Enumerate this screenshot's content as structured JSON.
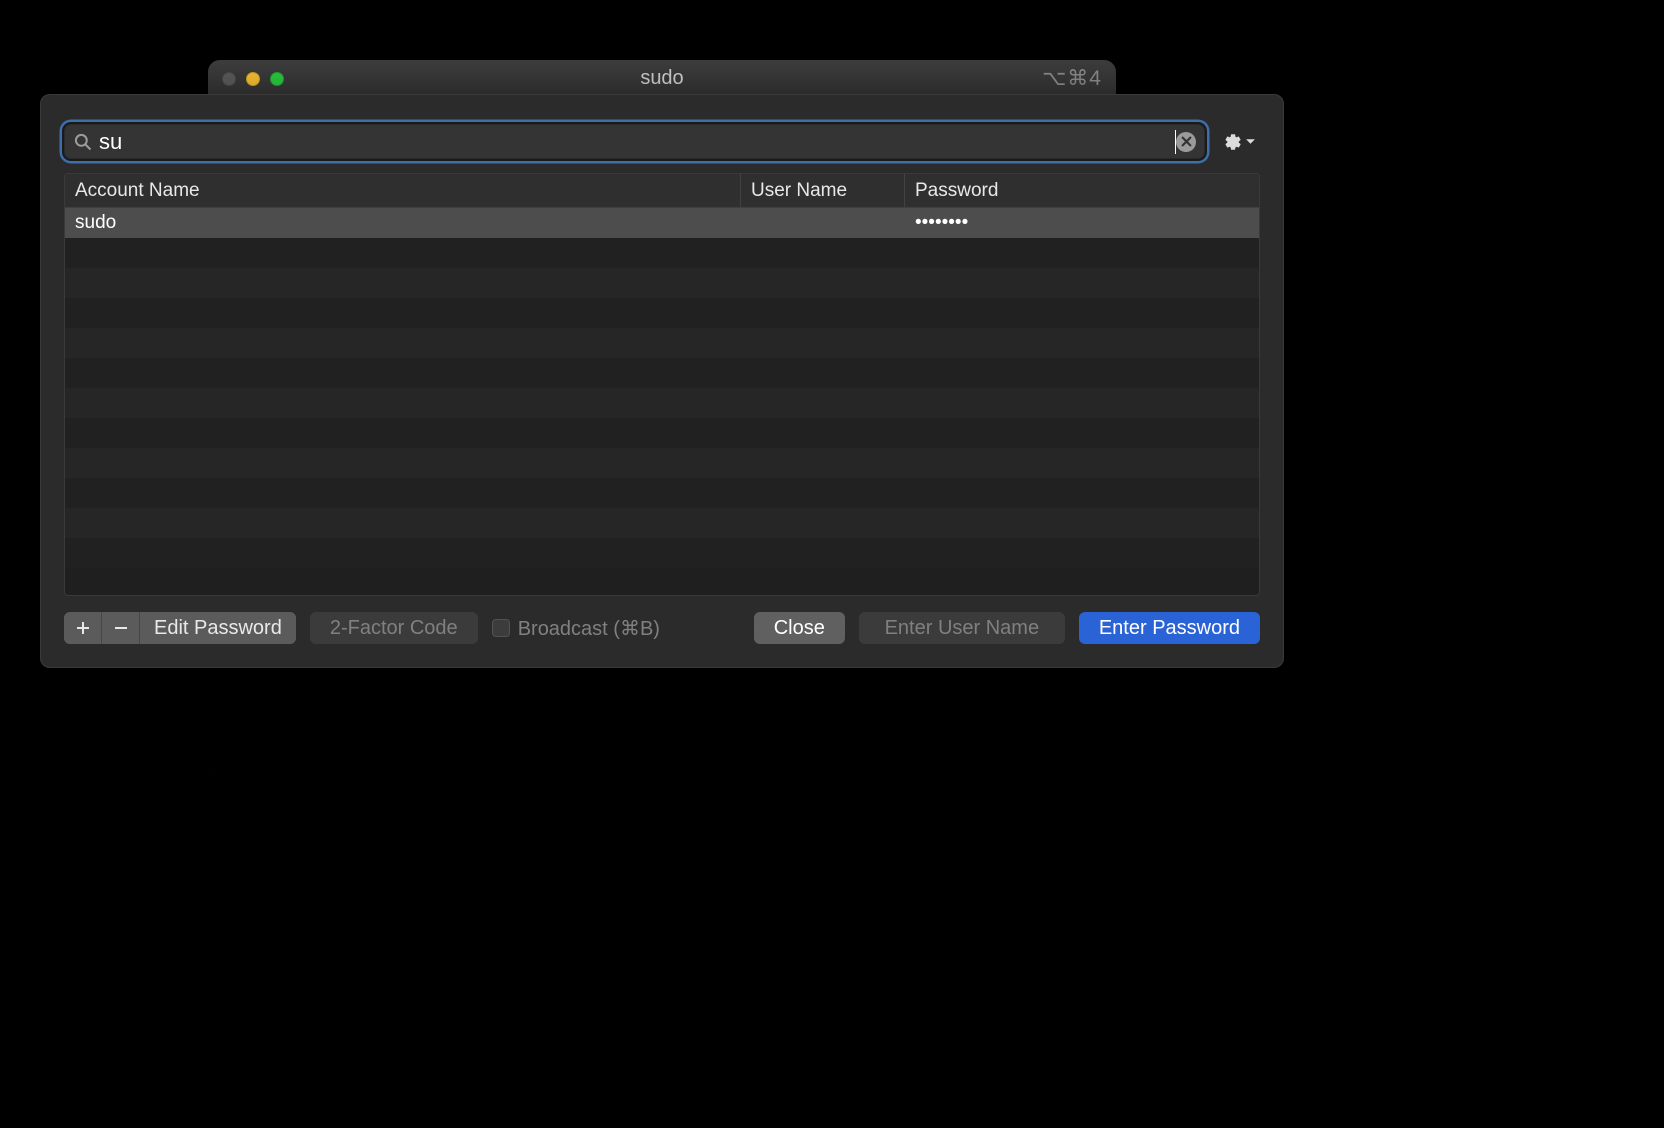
{
  "window": {
    "title": "sudo",
    "shortcut_hint": "⌥⌘4"
  },
  "search": {
    "value": "su"
  },
  "table": {
    "headers": {
      "account": "Account Name",
      "user": "User Name",
      "password": "Password"
    },
    "rows": [
      {
        "account": "sudo",
        "user": "",
        "password": "••••••••",
        "selected": true
      }
    ],
    "empty_row_count": 11
  },
  "footer": {
    "edit_password": "Edit Password",
    "two_factor": "2-Factor Code",
    "broadcast": "Broadcast (⌘B)",
    "close": "Close",
    "enter_user": "Enter User Name",
    "enter_password": "Enter Password"
  }
}
